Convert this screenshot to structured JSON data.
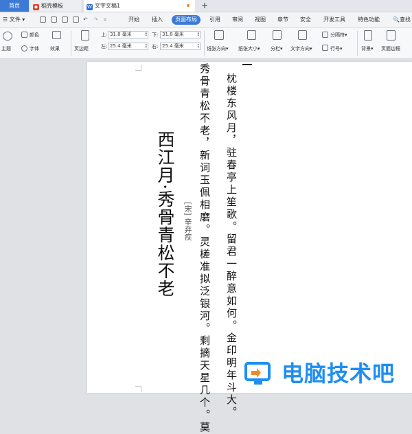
{
  "tabs": {
    "home": "首页",
    "template": "稻壳模板",
    "document": "文字文稿1",
    "new_tab": "+"
  },
  "menu": {
    "file": "文件",
    "items": [
      "开始",
      "插入",
      "页面布局",
      "引用",
      "审阅",
      "视图",
      "章节",
      "安全",
      "开发工具",
      "特色功能"
    ],
    "active": "页面布局",
    "search": "查找"
  },
  "ribbon": {
    "theme": "主题",
    "colors": "颜色",
    "fonts": "字体",
    "effects": "效果",
    "margins": "页边距",
    "top_label": "上:",
    "top_value": "31.8 毫米",
    "bottom_label": "下:",
    "bottom_value": "31.8 毫米",
    "left_label": "左:",
    "left_value": "25.4 毫米",
    "right_label": "右:",
    "right_value": "25.4 毫米",
    "orientation": "纸张方向",
    "size": "纸张大小",
    "columns": "分栏",
    "text_direction": "文字方向",
    "separator": "分隔符",
    "line_numbers": "行号",
    "background": "背景",
    "page_border": "页面边框"
  },
  "document": {
    "title": "西江月·秀骨青松不老",
    "author": "[宋] 辛弃疾",
    "line1": "枕楼东风月，驻春亭上笙歌。留君一醉意如何。金印明年斗大。",
    "line2": "秀骨青松不老，新词玉佩相磨。灵槎准拟泛银河。剩摘天星几个。莫"
  },
  "watermark": {
    "text": "电脑技术吧"
  },
  "colors": {
    "accent": "#3c7ad6",
    "watermark": "#1f8ef1",
    "tab_orange": "#f08a24"
  }
}
